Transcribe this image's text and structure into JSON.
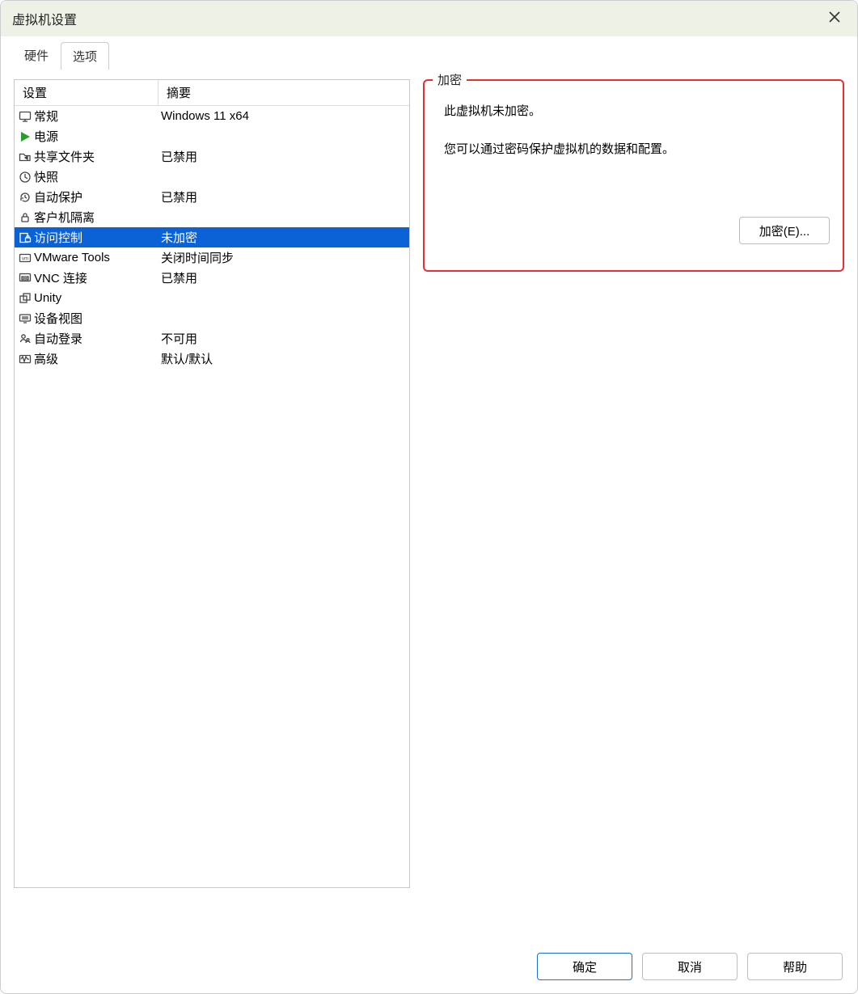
{
  "window": {
    "title": "虚拟机设置"
  },
  "tabs": {
    "hardware": "硬件",
    "options": "选项"
  },
  "columns": {
    "setting": "设置",
    "summary": "摘要"
  },
  "rows": [
    {
      "name": "常规",
      "summary": "Windows 11 x64",
      "icon": "monitor"
    },
    {
      "name": "电源",
      "summary": "",
      "icon": "play"
    },
    {
      "name": "共享文件夹",
      "summary": "已禁用",
      "icon": "folder-share"
    },
    {
      "name": "快照",
      "summary": "",
      "icon": "clock-snap"
    },
    {
      "name": "自动保护",
      "summary": "已禁用",
      "icon": "clock-back"
    },
    {
      "name": "客户机隔离",
      "summary": "",
      "icon": "lock"
    },
    {
      "name": "访问控制",
      "summary": "未加密",
      "icon": "box-lock",
      "selected": true
    },
    {
      "name": "VMware Tools",
      "summary": "关闭时间同步",
      "icon": "vm-box"
    },
    {
      "name": "VNC 连接",
      "summary": "已禁用",
      "icon": "vnc"
    },
    {
      "name": "Unity",
      "summary": "",
      "icon": "overlap"
    },
    {
      "name": "设备视图",
      "summary": "",
      "icon": "device-view"
    },
    {
      "name": "自动登录",
      "summary": "不可用",
      "icon": "user"
    },
    {
      "name": "高级",
      "summary": "默认/默认",
      "icon": "wave"
    }
  ],
  "group": {
    "title": "加密",
    "line1": "此虚拟机未加密。",
    "line2": "您可以通过密码保护虚拟机的数据和配置。",
    "encrypt_btn": "加密(E)..."
  },
  "footer": {
    "ok": "确定",
    "cancel": "取消",
    "help": "帮助"
  }
}
